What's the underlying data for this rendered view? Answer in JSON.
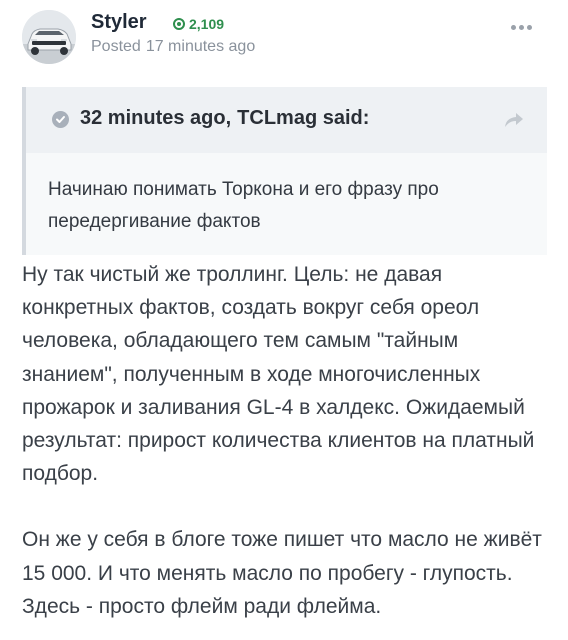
{
  "post": {
    "author": "Styler",
    "reputation": "2,109",
    "posted_label": "Posted",
    "posted_time": "17 minutes ago",
    "more_icon": "more-dots-icon"
  },
  "quote": {
    "time": "32 minutes ago,",
    "author_said": "TCLmag said:",
    "text": "Начинаю понимать Торкона и его фразу про передергивание фактов",
    "icons": [
      "check-circle-icon",
      "share-icon"
    ]
  },
  "content": {
    "paragraphs": [
      "Ну так чистый же троллинг. Цель: не давая конкретных фактов, создать вокруг себя ореол человека, обладающего тем самым \"тайным знанием\", полученным в ходе многочисленных прожарок и заливания GL-4 в халдекс. Ожидаемый результат: прирост количества клиентов на платный подбор.",
      "Он же у себя в блоге тоже пишет что масло не живёт 15 000. И что менять масло по пробегу - глупость. Здесь - просто флейм ради флейма."
    ]
  },
  "colors": {
    "reputation": "#2f8f4e",
    "muted": "#8a929c",
    "quote_border": "#d4d9df",
    "quote_header_bg": "#eef1f4"
  }
}
